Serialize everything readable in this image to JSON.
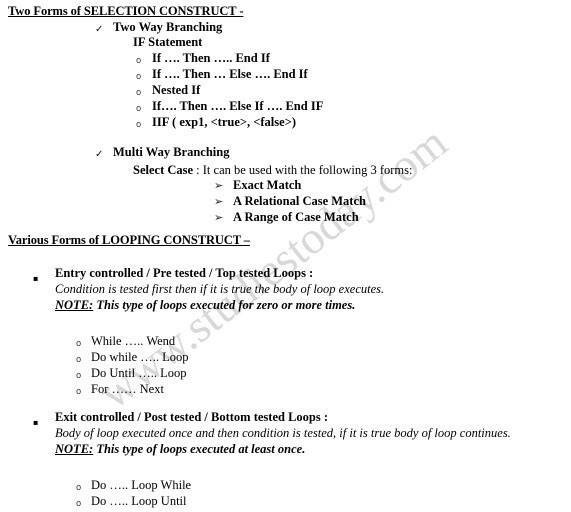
{
  "document": {
    "watermark": "www.studiestoday.com",
    "watermark_color": "#d8d8d8",
    "background_color": "#ffffff",
    "text_color": "#000000"
  },
  "sections": {
    "selection": {
      "heading": "Two Forms of SELECTION CONSTRUCT -",
      "two_way": {
        "bullet": "✓",
        "label": "Two Way Branching",
        "sub_label": "IF Statement",
        "items_bullet": "o",
        "items": [
          "If …. Then ….. End If",
          "If …. Then … Else …. End If",
          "Nested If",
          "If…. Then …. Else If …. End IF",
          "IIF (  exp1, <true>, <false>)"
        ]
      },
      "multi_way": {
        "bullet": "✓",
        "label": "Multi Way Branching",
        "select_case_label": "Select Case",
        "select_case_rest": " : It can be used with the following 3 forms:",
        "items_bullet": "➢",
        "items": [
          "Exact Match",
          "A Relational Case Match",
          "A Range of Case Match"
        ]
      }
    },
    "looping": {
      "heading": "Various Forms of LOOPING CONSTRUCT –",
      "groups": [
        {
          "bullet": "▪",
          "title": "Entry controlled / Pre tested / Top tested Loops :",
          "description": "Condition is tested first then if it is true the body of loop executes.",
          "note_label": "NOTE:",
          "note_text": " This type of loops executed for zero or more times.",
          "items_bullet": "o",
          "items": [
            "While ….. Wend",
            "Do while ….. Loop",
            "Do Until ….. Loop",
            "For …… Next"
          ]
        },
        {
          "bullet": "▪",
          "title": "Exit controlled / Post tested / Bottom tested Loops :",
          "description": "Body of loop executed once and then condition is tested, if it is true body of loop continues.",
          "note_label": "NOTE:",
          "note_text": " This type of loops executed at least once.",
          "items_bullet": "o",
          "items": [
            "Do ….. Loop While",
            "Do ….. Loop Until"
          ]
        }
      ]
    }
  }
}
